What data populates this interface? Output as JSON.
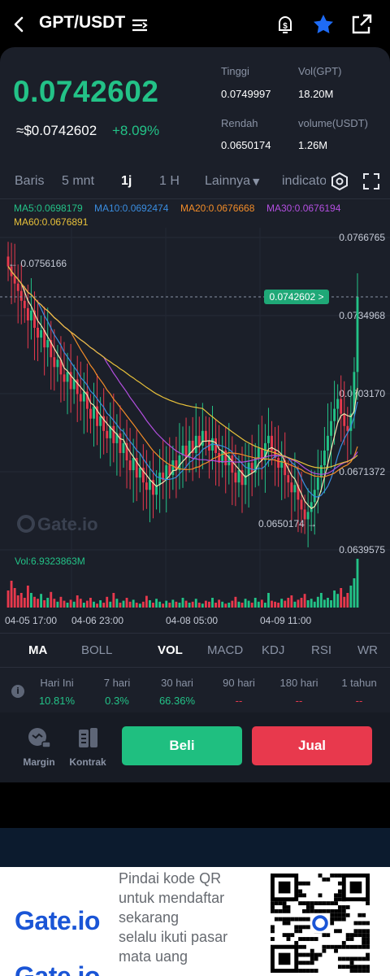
{
  "header": {
    "title": "GPT/USDT"
  },
  "ticker": {
    "price": "0.0742602",
    "fiat_price": "≈$0.0742602",
    "change": "+8.09%",
    "high_label": "Tinggi",
    "high_value": "0.0749997",
    "vol_label": "Vol(GPT)",
    "vol_value": "18.20M",
    "low_label": "Rendah",
    "low_value": "0.0650174",
    "volq_label": "volume(USDT)",
    "volq_value": "1.26M"
  },
  "timeframes": {
    "items": [
      "Baris",
      "5 mnt",
      "1j",
      "1 H",
      "Lainnya",
      "indicato"
    ],
    "active": "1j"
  },
  "ma": {
    "ma5": "MA5:0.0698179",
    "ma10": "MA10:0.0692474",
    "ma20": "MA20:0.0676668",
    "ma30": "MA30:0.0676194",
    "ma60": "MA60:0.0676891"
  },
  "chart_labels": {
    "axis": [
      "0.0766765",
      "0.0734968",
      "0.0703170",
      "0.0671372",
      "0.0639575"
    ],
    "max_marker": "← 0.0756166",
    "min_marker": "0.0650174 →",
    "current_tag": "0.0742602 >",
    "watermark": "Gate.io",
    "vol_label": "Vol:6.9323863M",
    "time": [
      "04-05 17:00",
      "04-06 23:00",
      "04-08 05:00",
      "04-09 11:00"
    ]
  },
  "chart_data": {
    "type": "candlestick",
    "y_range": [
      0.0639575,
      0.0766765
    ],
    "y_ticks": [
      0.0766765,
      0.0734968,
      0.070317,
      0.0671372,
      0.0639575
    ],
    "x_ticks": [
      "04-05 17:00",
      "04-06 23:00",
      "04-08 05:00",
      "04-09 11:00"
    ],
    "last_price": 0.0742602,
    "high_marker": 0.0756166,
    "low_marker": 0.0650174,
    "series": [
      {
        "name": "MA5",
        "color": "#f3e7b1",
        "last": 0.0698179
      },
      {
        "name": "MA10",
        "color": "#3a8de0",
        "last": 0.0692474
      },
      {
        "name": "MA20",
        "color": "#f28c28",
        "last": 0.0676668
      },
      {
        "name": "MA30",
        "color": "#b34fe0",
        "last": 0.0676194
      },
      {
        "name": "MA60",
        "color": "#e8c13a",
        "last": 0.0676891
      }
    ],
    "candles": [
      0.0755,
      0.0751,
      0.0748,
      0.0745,
      0.0741,
      0.0738,
      0.0733,
      0.0737,
      0.073,
      0.0726,
      0.0729,
      0.0722,
      0.0725,
      0.0718,
      0.0714,
      0.0717,
      0.0711,
      0.0708,
      0.0712,
      0.0705,
      0.0709,
      0.0703,
      0.07,
      0.0704,
      0.0697,
      0.0693,
      0.0698,
      0.069,
      0.0694,
      0.0688,
      0.0685,
      0.069,
      0.0683,
      0.0687,
      0.0679,
      0.0683,
      0.0676,
      0.0672,
      0.0677,
      0.0669,
      0.0673,
      0.0667,
      0.0664,
      0.0668,
      0.0662,
      0.0666,
      0.0671,
      0.0668,
      0.0674,
      0.067,
      0.0676,
      0.0672,
      0.0678,
      0.0682,
      0.0677,
      0.0684,
      0.0679,
      0.0686,
      0.0682,
      0.0688,
      0.0684,
      0.068,
      0.0685,
      0.0679,
      0.0675,
      0.068,
      0.0674,
      0.0678,
      0.0671,
      0.0667,
      0.0672,
      0.0666,
      0.067,
      0.0675,
      0.0671,
      0.0677,
      0.0681,
      0.0676,
      0.0683,
      0.0686,
      0.068,
      0.0677,
      0.0673,
      0.0676,
      0.067,
      0.0667,
      0.0663,
      0.0666,
      0.066,
      0.0656,
      0.0652,
      0.0655,
      0.0659,
      0.0664,
      0.0669,
      0.0674,
      0.068,
      0.0686,
      0.0692,
      0.0697,
      0.0701,
      0.0695,
      0.069,
      0.0688,
      0.0695,
      0.0712,
      0.0742602
    ],
    "volumes": [
      0.35,
      0.55,
      0.4,
      0.25,
      0.3,
      0.2,
      0.45,
      0.3,
      0.22,
      0.18,
      0.28,
      0.15,
      0.2,
      0.32,
      0.18,
      0.12,
      0.22,
      0.14,
      0.1,
      0.16,
      0.12,
      0.25,
      0.18,
      0.1,
      0.14,
      0.2,
      0.12,
      0.08,
      0.15,
      0.1,
      0.22,
      0.12,
      0.3,
      0.18,
      0.1,
      0.14,
      0.2,
      0.12,
      0.16,
      0.1,
      0.08,
      0.12,
      0.24,
      0.15,
      0.1,
      0.18,
      0.12,
      0.08,
      0.14,
      0.1,
      0.16,
      0.12,
      0.1,
      0.2,
      0.14,
      0.1,
      0.12,
      0.18,
      0.1,
      0.08,
      0.14,
      0.12,
      0.2,
      0.1,
      0.16,
      0.12,
      0.08,
      0.1,
      0.14,
      0.22,
      0.12,
      0.1,
      0.18,
      0.14,
      0.1,
      0.2,
      0.12,
      0.16,
      0.1,
      0.3,
      0.14,
      0.12,
      0.1,
      0.18,
      0.14,
      0.2,
      0.25,
      0.12,
      0.16,
      0.2,
      0.28,
      0.15,
      0.18,
      0.12,
      0.22,
      0.3,
      0.16,
      0.2,
      0.15,
      0.35,
      0.28,
      0.4,
      0.22,
      0.3,
      0.45,
      0.6,
      1.0
    ]
  },
  "indicators": {
    "items": [
      "MA",
      "BOLL",
      "VOL",
      "MACD",
      "KDJ",
      "RSI",
      "WR"
    ],
    "active": [
      "MA",
      "VOL"
    ]
  },
  "performance": {
    "headers": [
      "Hari Ini",
      "7 hari",
      "30 hari",
      "90 hari",
      "180 hari",
      "1 tahun"
    ],
    "values": [
      "10.81%",
      "0.3%",
      "66.36%",
      "--",
      "--",
      "--"
    ]
  },
  "actions": {
    "margin": "Margin",
    "kontrak": "Kontrak",
    "buy": "Beli",
    "sell": "Jual"
  },
  "ad": {
    "logo": "Gate.io",
    "text": "Pindai kode QR\nuntuk mendaftar\nsekarang\n selalu ikuti pasar\nmata uang"
  },
  "colors": {
    "up": "#23c287",
    "down": "#e8394d",
    "star": "#1e6bf5"
  }
}
